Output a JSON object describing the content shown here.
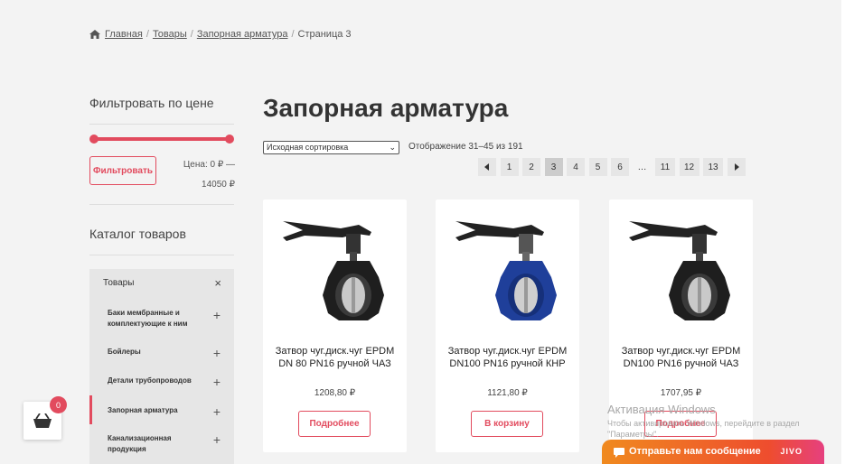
{
  "breadcrumb": {
    "home": "Главная",
    "products": "Товары",
    "category": "Запорная арматура",
    "current": "Страница 3",
    "separator": "/"
  },
  "sidebar": {
    "filter_title": "Фильтровать по цене",
    "filter_button": "Фильтровать",
    "price_range": "Цена: 0 ₽ — 14050 ₽",
    "catalog_title": "Каталог товаров",
    "catalog_head": "Товары",
    "catalog_items": [
      {
        "label": "Баки мембранные и комплектующие к ним"
      },
      {
        "label": "Бойлеры"
      },
      {
        "label": "Детали трубопроводов"
      },
      {
        "label": "Запорная арматура"
      },
      {
        "label": "Канализационная продукция"
      }
    ]
  },
  "main": {
    "title": "Запорная арматура",
    "sort_value": "Исходная сортировка",
    "result_count": "Отображение 31–45 из 191",
    "pagination": [
      "1",
      "2",
      "3",
      "4",
      "5",
      "6",
      "…",
      "11",
      "12",
      "13"
    ],
    "current_page": "3",
    "products": [
      {
        "name": "Затвор чуг.диск.чуг EPDM DN 80 PN16 ручной ЧАЗ",
        "price": "1208,80 ₽",
        "button": "Подробнее",
        "body_color": "#1e1e1e"
      },
      {
        "name": "Затвор чуг.диск.чуг EPDM DN100 PN16 ручной КНР",
        "price": "1121,80 ₽",
        "button": "В корзину",
        "body_color": "#1f3f9a"
      },
      {
        "name": "Затвор чуг.диск.чуг EPDM DN100 PN16 ручной ЧАЗ",
        "price": "1707,95 ₽",
        "button": "Подробнее",
        "body_color": "#1e1e1e"
      }
    ]
  },
  "watermark": {
    "line1": "Активация Windows",
    "line2": "Чтобы активировать Windows, перейдите в раздел \"Параметры\"."
  },
  "cart": {
    "count": "0"
  },
  "chat": {
    "label": "Отправьте нам сообщение",
    "brand": "JIVO"
  },
  "colors": {
    "accent": "#e24b5e",
    "background": "#f3f3f3"
  }
}
